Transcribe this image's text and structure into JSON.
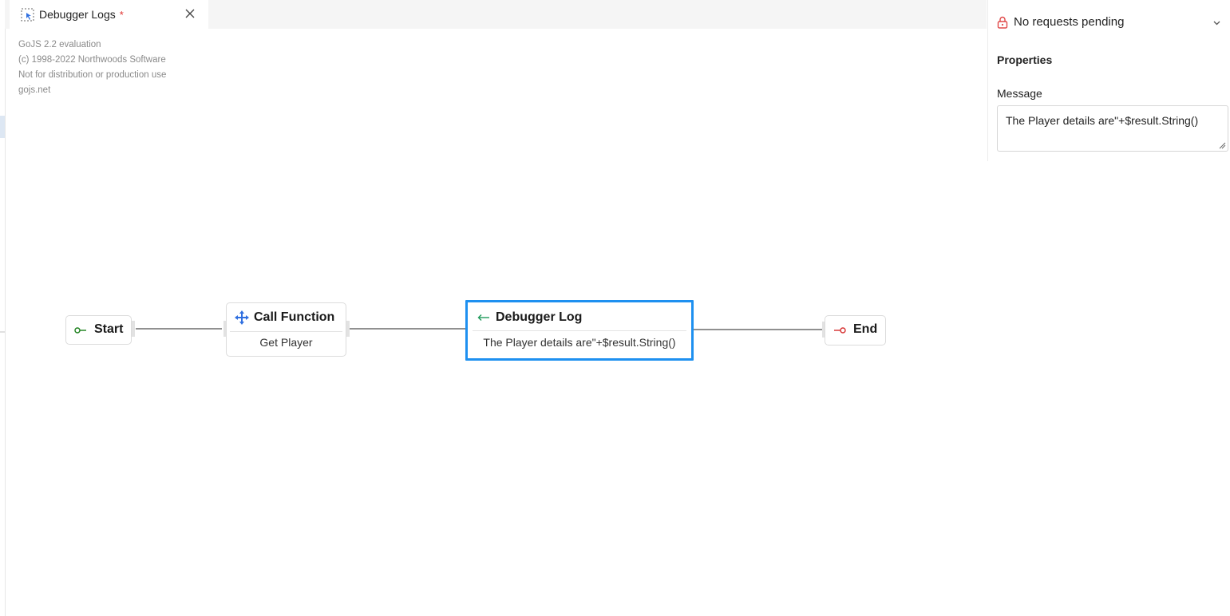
{
  "tab": {
    "title": "Debugger Logs",
    "dirty_marker": "*"
  },
  "watermark": {
    "line1": "GoJS 2.2 evaluation",
    "line2": "(c) 1998-2022 Northwoods Software",
    "line3": "Not for distribution or production use",
    "line4": "gojs.net"
  },
  "requests": {
    "status": "No requests pending"
  },
  "properties": {
    "title": "Properties",
    "message_label": "Message",
    "message_value": "The Player details are\"+$result.String()"
  },
  "nodes": {
    "start": {
      "label": "Start"
    },
    "call_function": {
      "title": "Call Function",
      "subtitle": "Get Player"
    },
    "debugger_log": {
      "title": "Debugger Log",
      "subtitle": "The Player details are\"+$result.String()"
    },
    "end": {
      "label": "End"
    }
  },
  "colors": {
    "selection": "#1e90f0",
    "start_icon": "#1a7f1a",
    "end_icon": "#d62f2f",
    "call_icon": "#2f6fe0",
    "log_icon": "#1f9a5a",
    "lock_icon": "#e04848",
    "dirty": "#e0322f"
  }
}
